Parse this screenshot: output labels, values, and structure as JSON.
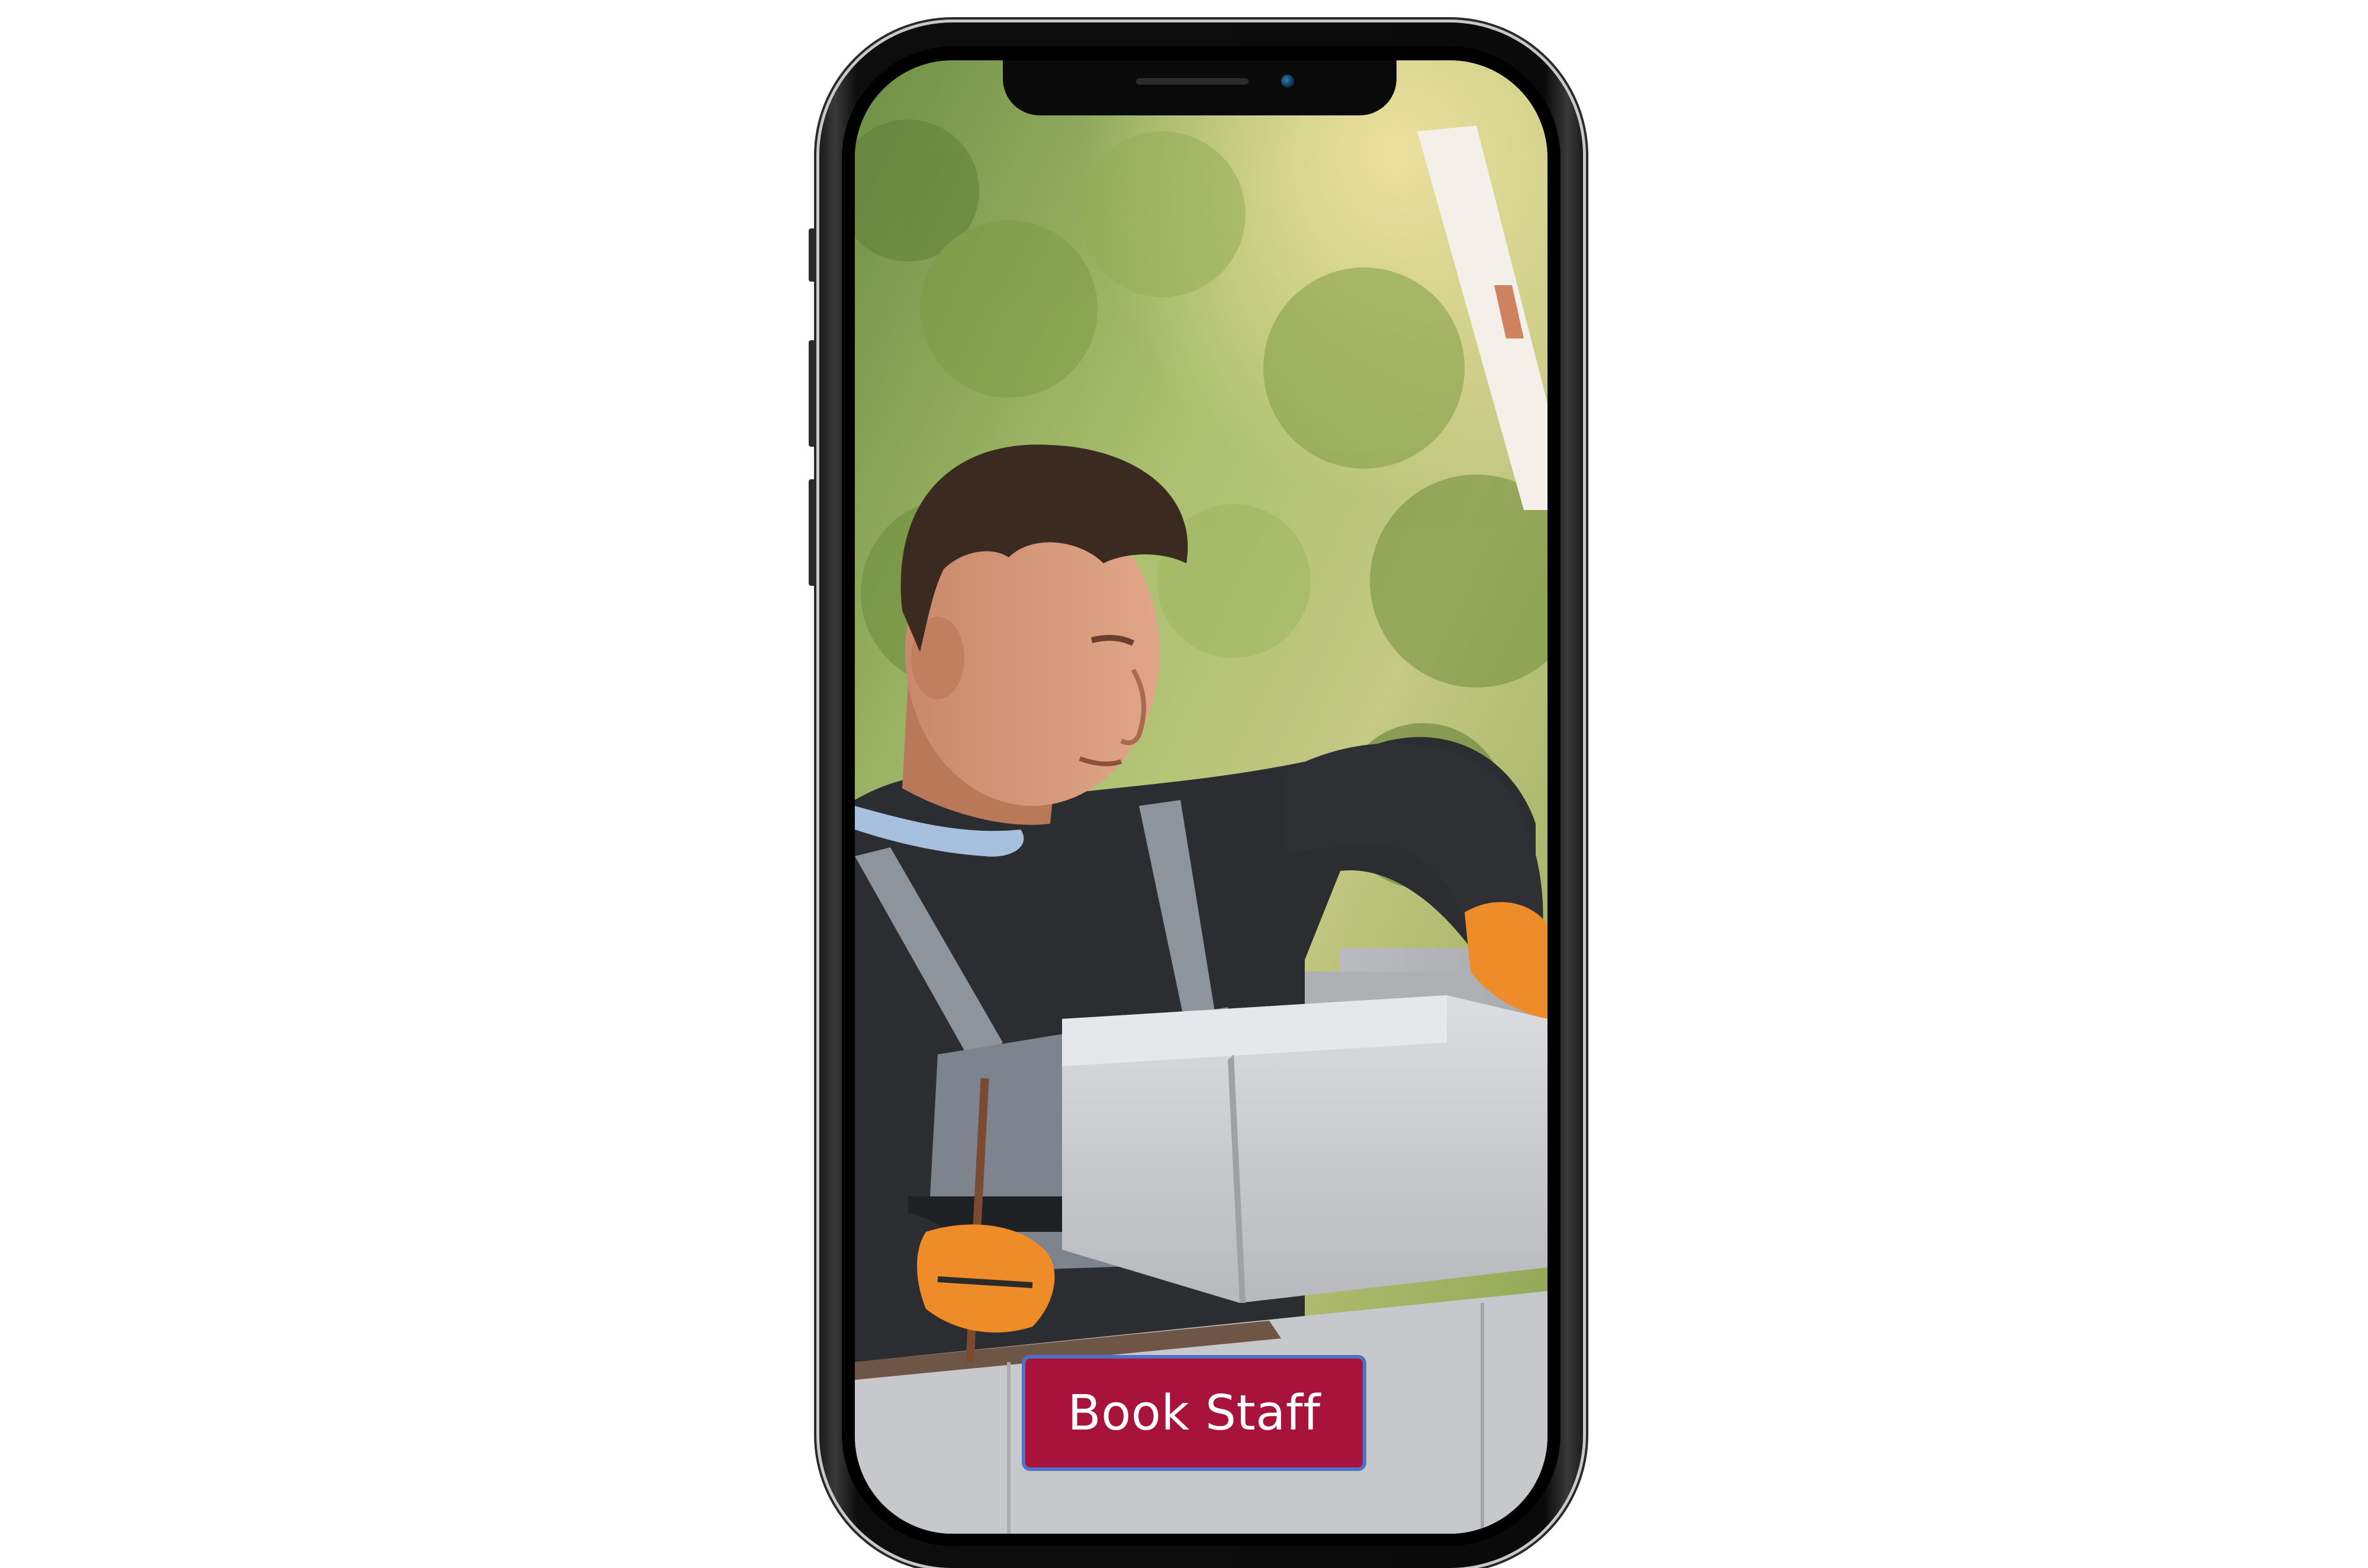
{
  "app": {
    "cta": {
      "label": "Book Staff",
      "background": "#a8133c",
      "border": "#4d73c9",
      "text_color": "#ffffff"
    }
  },
  "hero_image": {
    "subject": "construction-worker-laying-concrete-blocks",
    "icon": "photo-icon"
  },
  "device": {
    "model": "phone-mockup",
    "frame_color": "#0a0a0a"
  }
}
